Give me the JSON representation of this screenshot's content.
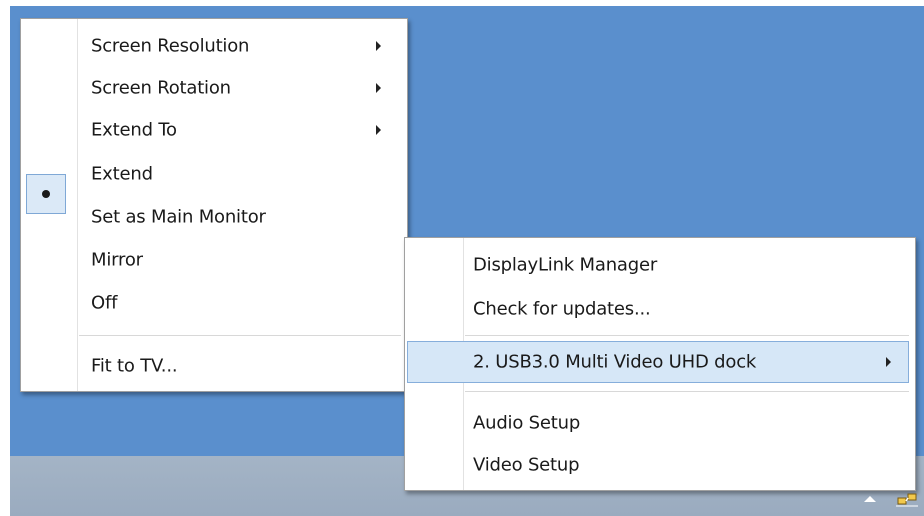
{
  "main_menu": {
    "items": [
      {
        "label": "Screen Resolution"
      },
      {
        "label": "Screen Rotation"
      },
      {
        "label": "Extend To"
      },
      {
        "label": "Extend"
      },
      {
        "label": "Set as Main Monitor"
      },
      {
        "label": "Mirror"
      },
      {
        "label": "Off"
      },
      {
        "label": "Fit to TV..."
      }
    ]
  },
  "tray_menu": {
    "items": [
      {
        "label": "DisplayLink Manager"
      },
      {
        "label": "Check for updates..."
      },
      {
        "label": "2. USB3.0 Multi Video UHD dock"
      },
      {
        "label": "Audio Setup"
      },
      {
        "label": "Video Setup"
      }
    ]
  },
  "icons": {
    "selected_mark": "radio-dot-icon",
    "submenu": "chevron-right-icon",
    "tray_expand": "caret-up-icon",
    "tray_app": "network-icon"
  },
  "colors": {
    "desktop": "#5a8fcd",
    "taskbar": "#9fb0c3",
    "highlight": "#d6e7f7",
    "highlight_border": "#86aedb"
  }
}
